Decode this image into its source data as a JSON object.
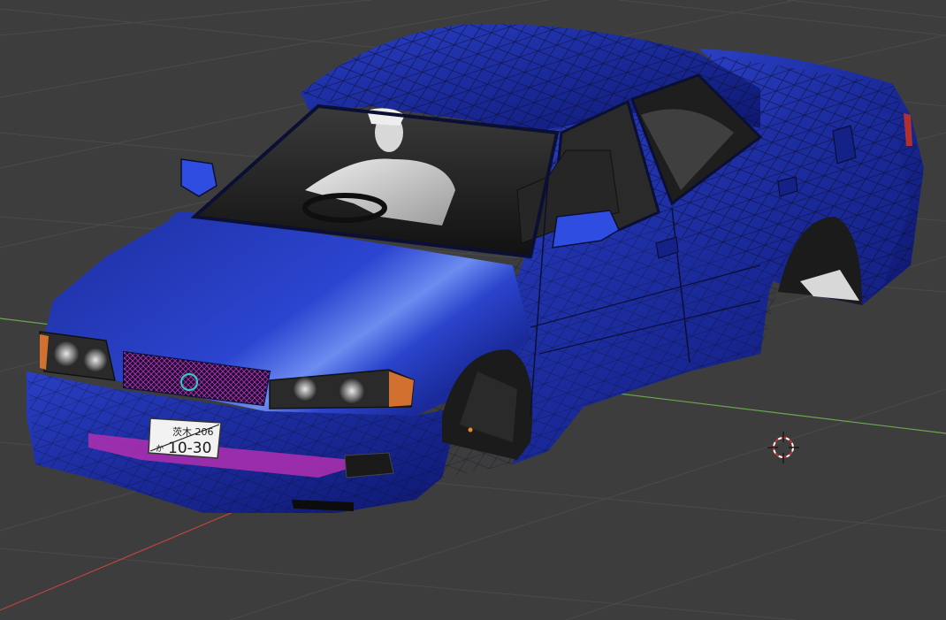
{
  "viewport": {
    "background": "#3d3d3d",
    "grid_color": "#4a4a4a",
    "x_axis_color": "#c0443f",
    "y_axis_color": "#6aa84f",
    "cursor_icon": "3d-cursor-icon"
  },
  "model": {
    "body_color": "#1f2f9e",
    "highlight_color": "#3a56e0",
    "wire_color": "#0b0f33",
    "grille_accent": "#b02fb0"
  },
  "license_plate": {
    "line1": "茨木 206",
    "line2": "10-30",
    "prefix": "か"
  }
}
